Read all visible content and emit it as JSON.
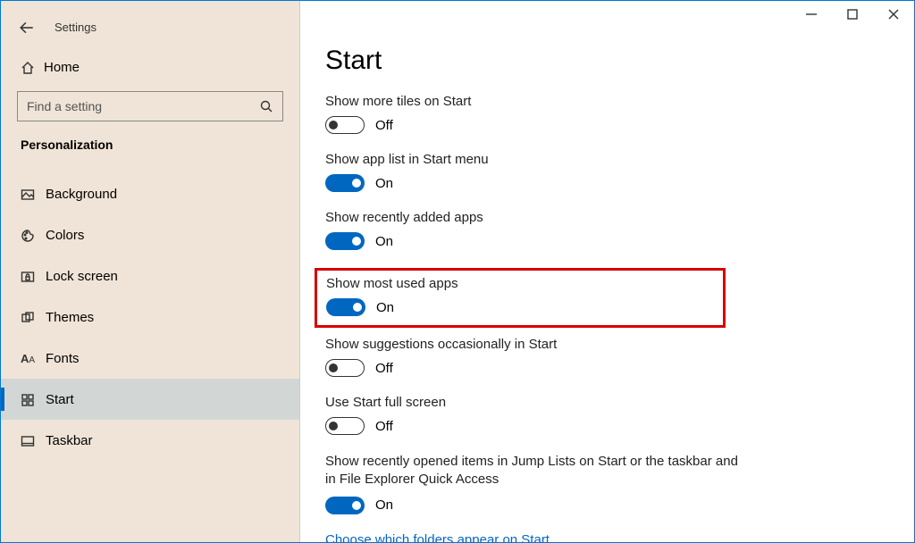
{
  "window": {
    "app_title": "Settings"
  },
  "sidebar": {
    "home_label": "Home",
    "search_placeholder": "Find a setting",
    "section_title": "Personalization",
    "items": [
      {
        "label": "Background"
      },
      {
        "label": "Colors"
      },
      {
        "label": "Lock screen"
      },
      {
        "label": "Themes"
      },
      {
        "label": "Fonts"
      },
      {
        "label": "Start"
      },
      {
        "label": "Taskbar"
      }
    ]
  },
  "main": {
    "title": "Start",
    "settings": [
      {
        "label": "Show more tiles on Start",
        "state": "Off",
        "on": false
      },
      {
        "label": "Show app list in Start menu",
        "state": "On",
        "on": true
      },
      {
        "label": "Show recently added apps",
        "state": "On",
        "on": true
      },
      {
        "label": "Show most used apps",
        "state": "On",
        "on": true,
        "highlight": true
      },
      {
        "label": "Show suggestions occasionally in Start",
        "state": "Off",
        "on": false
      },
      {
        "label": "Use Start full screen",
        "state": "Off",
        "on": false
      },
      {
        "label": "Show recently opened items in Jump Lists on Start or the taskbar and in File Explorer Quick Access",
        "state": "On",
        "on": true
      }
    ],
    "link": "Choose which folders appear on Start"
  }
}
